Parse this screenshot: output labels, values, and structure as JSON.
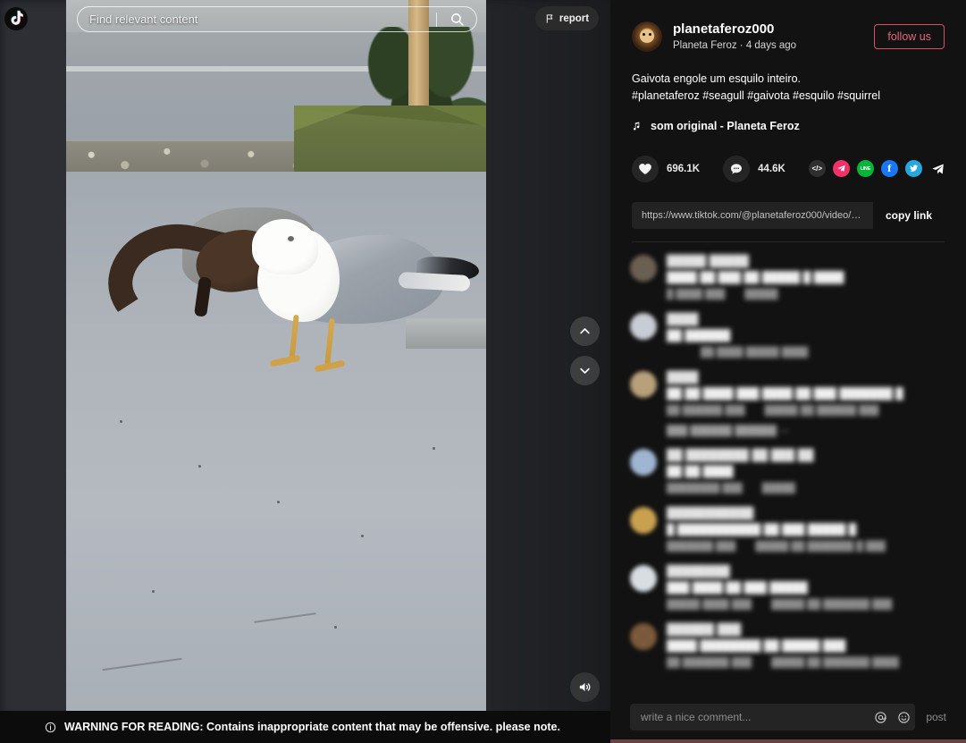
{
  "brand": {
    "logo_icon": "tiktok-logo-icon"
  },
  "video_overlay": {
    "search_placeholder": "Find relevant content",
    "search_icon": "search-icon",
    "report_label": "report",
    "report_icon": "flag-icon",
    "prev_icon": "chevron-up-icon",
    "next_icon": "chevron-down-icon",
    "volume_icon": "speaker-on-icon"
  },
  "warning": {
    "icon": "info-circle-icon",
    "text": "WARNING FOR READING: Contains inappropriate content that may be offensive. please note."
  },
  "author": {
    "avatar_icon": "lion-avatar",
    "username": "planetaferoz000",
    "display_name_and_time": "Planeta Feroz · 4 days ago",
    "follow_label": "follow us",
    "follow_color": "#e8637d"
  },
  "post": {
    "caption": "Gaivota engole um esquilo inteiro.",
    "hashtags": "#planetaferoz #seagull #gaivota #esquilo #squirrel",
    "music_icon": "music-note-icon",
    "music_label": "som original - Planeta Feroz"
  },
  "stats": {
    "like_icon": "heart-icon",
    "like_count": "696.1K",
    "comment_icon": "comment-bubble-icon",
    "comment_count": "44.6K"
  },
  "share": {
    "buttons": [
      {
        "name": "embed-icon",
        "glyph": "</>",
        "color": "#2f2f2f"
      },
      {
        "name": "telegram-icon",
        "glyph": "➤",
        "color": "#f0316a"
      },
      {
        "name": "line-icon",
        "glyph": "LINE",
        "color": "#07b53b"
      },
      {
        "name": "facebook-icon",
        "glyph": "f",
        "color": "#1877f2"
      },
      {
        "name": "twitter-icon",
        "glyph": "🐦",
        "color": "#26a7de"
      },
      {
        "name": "share-arrow-icon",
        "glyph": "➤",
        "color": "transparent"
      }
    ]
  },
  "link": {
    "url": "https://www.tiktok.com/@planetaferoz000/video/72464118…",
    "copy_label": "copy link"
  },
  "comments": [
    {
      "avatar_tint": "#6b5f52",
      "name": "█████ █████",
      "text": "████ ██ ███ ██ █████ █ ████",
      "time": "█ ████ ███",
      "reply": "█████",
      "view_more": ""
    },
    {
      "avatar_tint": "#c8ccd4",
      "name": "████",
      "text": "██ ██████",
      "time": "",
      "reply": "██ ████  █████ ████",
      "view_more": ""
    },
    {
      "avatar_tint": "#b7a07a",
      "name": "████",
      "text": "██ ██ ████ ███ ████ ██ ███ ███████ █",
      "time": "██ ██████ ███",
      "reply": "█████ ██ ██████ ███",
      "view_more": "███ ██████ ██████ —"
    },
    {
      "avatar_tint": "#9fb6d2",
      "name": "██ ████████ ██ ███ ██",
      "text": "██ ██ ████",
      "time": "████████ ███",
      "reply": "█████",
      "view_more": ""
    },
    {
      "avatar_tint": "#c9a14e",
      "name": "███████████",
      "text": "█ ███████████ ██ ███ █████ █",
      "time": "███████ ███",
      "reply": "█████ ██ ███████ █ ███",
      "view_more": ""
    },
    {
      "avatar_tint": "#d8dde2",
      "name": "████████",
      "text": "███ ████ ██ ███ █████",
      "time": "█████ ████ ███",
      "reply": "█████ ██ ███████ ███",
      "view_more": ""
    },
    {
      "avatar_tint": "#7a5a3a",
      "name": "██████ ███",
      "text": "████ ████████ ██ █████ ███",
      "time": "██ ███████ ███",
      "reply": "█████ ██ ███████ ████",
      "view_more": ""
    }
  ],
  "comment_box": {
    "placeholder": "write a nice comment...",
    "mention_icon": "at-mention-icon",
    "emoji_icon": "emoji-smiley-icon",
    "post_label": "post"
  }
}
